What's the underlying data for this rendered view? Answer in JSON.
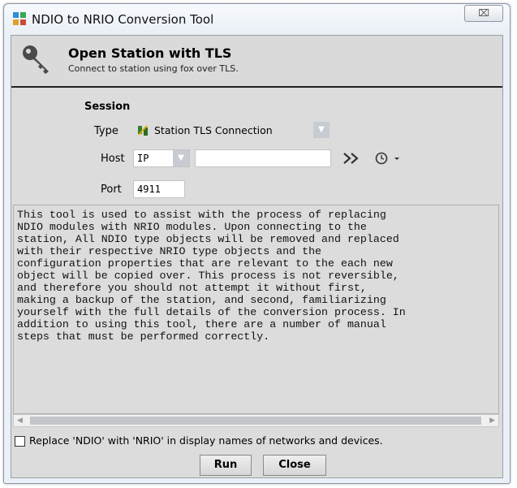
{
  "window": {
    "title": "NDIO to NRIO Conversion Tool",
    "close_glyph": "⌧"
  },
  "header": {
    "title": "Open Station with TLS",
    "subtitle": "Connect to station using fox over TLS.",
    "icon": "key-icon"
  },
  "session": {
    "heading": "Session",
    "type_label": "Type",
    "type_value": "Station TLS Connection",
    "host_label": "Host",
    "host_mode": "IP",
    "host_value": "",
    "port_label": "Port",
    "port_value": "4911"
  },
  "description": "This tool is used to assist with the process of replacing\nNDIO modules with NRIO modules. Upon connecting to the\nstation, All NDIO type objects will be removed and replaced\nwith their respective NRIO type objects and the\nconfiguration properties that are relevant to the each new\nobject will be copied over. This process is not reversible,\nand therefore you should not attempt it without first,\nmaking a backup of the station, and second, familiarizing\nyourself with the full details of the conversion process. In\naddition to using this tool, there are a number of manual\nsteps that must be performed correctly.",
  "checkbox": {
    "label": "Replace 'NDIO' with 'NRIO' in display names of networks and devices.",
    "checked": false
  },
  "buttons": {
    "run": "Run",
    "close": "Close"
  }
}
